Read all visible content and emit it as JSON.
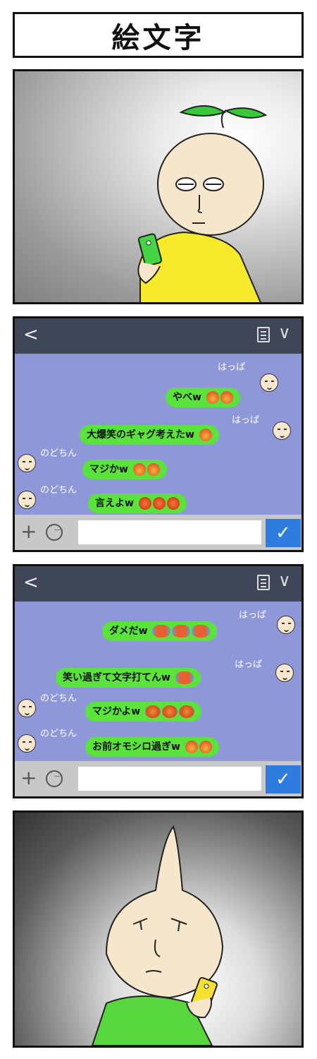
{
  "title": "絵文字",
  "panel2": {
    "rows": [
      {
        "name": "はっぱ",
        "text": "やべw",
        "emojis": [
          "grin-emoji",
          "grin-emoji"
        ]
      },
      {
        "name": "はっぱ",
        "text": "大爆笑のギャグ考えたw",
        "emojis": [
          "grin-emoji"
        ]
      },
      {
        "name": "のどちん",
        "text": "マジかw",
        "emojis": [
          "shock-emoji",
          "shock-emoji"
        ]
      },
      {
        "name": "のどちん",
        "text": "言えよw",
        "emojis": [
          "laugh-emoji",
          "laugh-emoji",
          "laugh-emoji"
        ]
      }
    ]
  },
  "panel3": {
    "rows": [
      {
        "name": "はっぱ",
        "text": "ダメだw",
        "emojis": [
          "tears-emoji",
          "tears-emoji",
          "tears-emoji"
        ]
      },
      {
        "name": "はっぱ",
        "text": "笑い過ぎて文字打てんw",
        "emojis": [
          "tears-emoji"
        ]
      },
      {
        "name": "のどちん",
        "text": "マジかよw",
        "emojis": [
          "grin-emoji",
          "grin-emoji",
          "grin-emoji"
        ]
      },
      {
        "name": "のどちん",
        "text": "お前オモシロ過ぎw",
        "emojis": [
          "cry-laugh-emoji",
          "cry-laugh-emoji"
        ]
      }
    ]
  },
  "ui": {
    "back": "<",
    "chevron": "∨",
    "plus": "+",
    "send": "✓"
  }
}
